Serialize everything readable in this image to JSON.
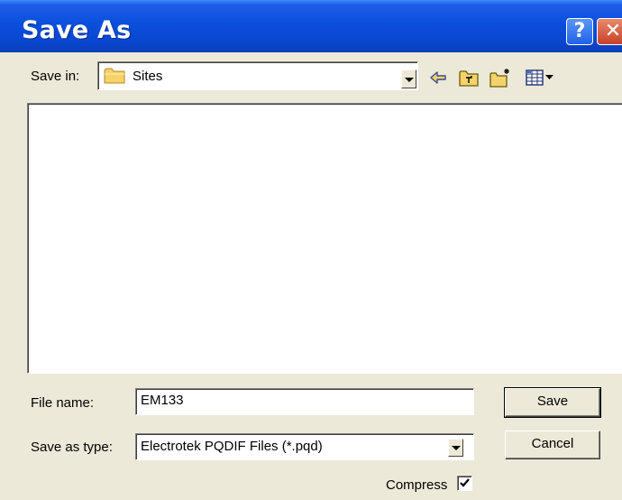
{
  "window": {
    "title": "Save As",
    "help_label": "?",
    "close_label": "✕"
  },
  "toolbar": {
    "save_in_label": "Save in:",
    "save_in_value": "Sites",
    "icons": [
      "back-arrow-icon",
      "up-folder-icon",
      "new-folder-icon",
      "view-menu-icon"
    ]
  },
  "form": {
    "file_name_label": "File name:",
    "file_name_value": "EM133",
    "save_as_type_label": "Save as type:",
    "save_as_type_value": "Electrotek PQDIF Files (*.pqd)",
    "compress_label": "Compress",
    "compress_checked": true
  },
  "buttons": {
    "save_label": "Save",
    "cancel_label": "Cancel"
  },
  "colors": {
    "title_bar": "#0a4fdc",
    "dialog_face": "#ece9d8",
    "folder": "#f5d36a"
  }
}
